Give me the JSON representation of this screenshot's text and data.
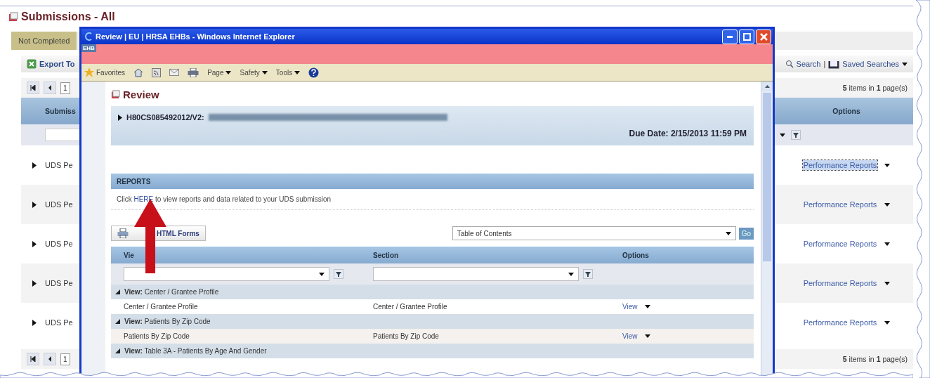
{
  "page": {
    "title": "Submissions - All"
  },
  "tabs": [
    {
      "label": "Not Completed",
      "selected": true
    }
  ],
  "toolbar": {
    "export": "Export To",
    "search": "Search",
    "separator": "|",
    "saved_searches": "Saved Searches"
  },
  "pager_top": {
    "page": "1",
    "summary": "**5** items in **1** page(s)"
  },
  "grid": {
    "columns": [
      "Submiss",
      "Options"
    ],
    "rows": [
      {
        "name": "UDS Pe",
        "option": "Performance Reports",
        "selected": true
      },
      {
        "name": "UDS Pe",
        "option": "Performance Reports",
        "selected": false
      },
      {
        "name": "UDS Pe",
        "option": "Performance Reports",
        "selected": false
      },
      {
        "name": "UDS Pe",
        "option": "Performance Reports",
        "selected": false
      },
      {
        "name": "UDS Pe",
        "option": "Performance Reports",
        "selected": false
      }
    ]
  },
  "pager_bottom": {
    "page": "1",
    "summary": "**5** items in **1** page(s)"
  },
  "popup": {
    "title": "Review | EU | HRSA EHBs - Windows Internet Explorer",
    "badge": "EHB",
    "commands": [
      {
        "kind": "star",
        "label": "Favorites"
      },
      {
        "kind": "home"
      },
      {
        "kind": "feed"
      },
      {
        "kind": "mail"
      },
      {
        "kind": "print"
      },
      {
        "kind": "menu",
        "label": "Page"
      },
      {
        "kind": "menu",
        "label": "Safety"
      },
      {
        "kind": "menu",
        "label": "Tools"
      },
      {
        "kind": "help"
      }
    ],
    "heading": "Review",
    "submission": {
      "id": "H80CS085492012/V2:",
      "due": "Due Date: 2/15/2013 11:59 PM"
    },
    "reports": {
      "title": "REPORTS",
      "before": "Click ",
      "link": "HERE",
      "after": " to view reports and data related to your UDS submission"
    },
    "print_button": "HTML Forms",
    "contents_select": "Table of Contents",
    "go_button": "Go",
    "columns": [
      "Vie",
      "Section",
      "Options"
    ],
    "groups": [
      {
        "label": "**View:** Center / Grantee Profile",
        "expanded": true,
        "rows": [
          {
            "view": "Center / Grantee Profile",
            "section": "Center / Grantee Profile",
            "option": "View"
          }
        ]
      },
      {
        "label": "**View:** Patients By Zip Code",
        "expanded": true,
        "rows": [
          {
            "view": "Patients By Zip Code",
            "section": "Patients By Zip Code",
            "option": "View"
          }
        ]
      },
      {
        "label": "**View:** Table 3A - Patients By Age And Gender",
        "expanded": true
      }
    ]
  }
}
